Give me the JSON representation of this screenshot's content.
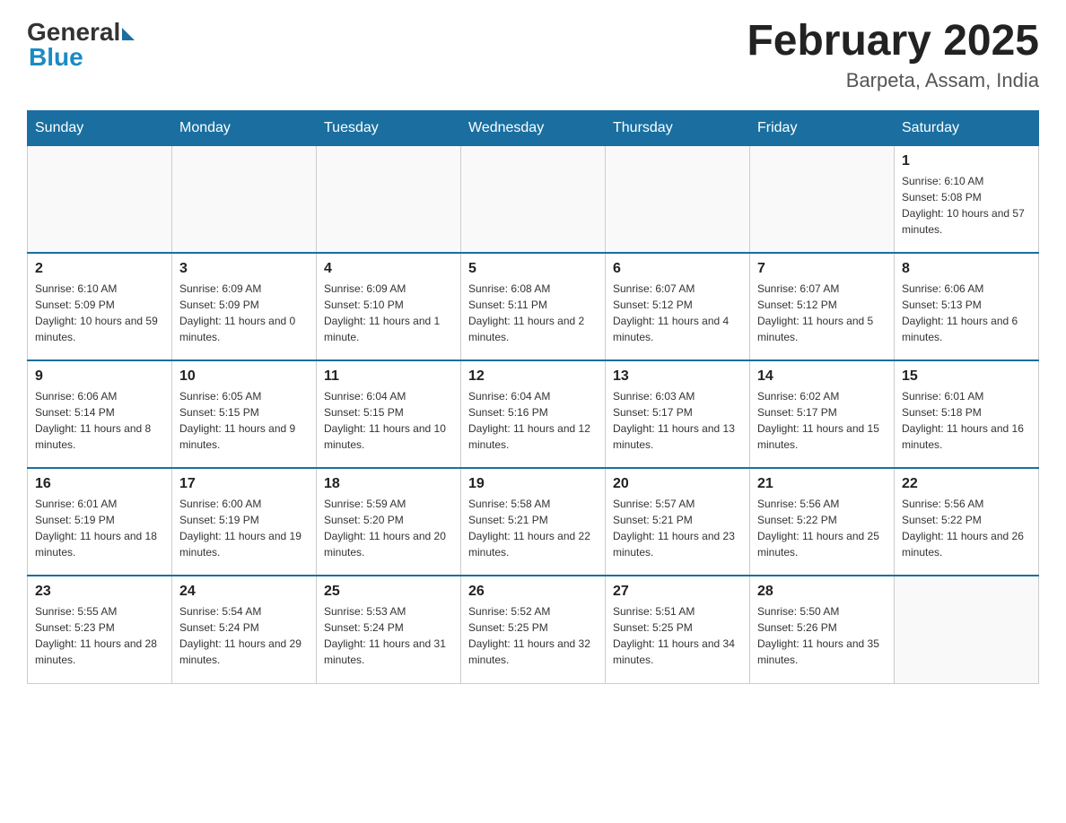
{
  "header": {
    "logo_general": "General",
    "logo_blue": "Blue",
    "month_title": "February 2025",
    "location": "Barpeta, Assam, India"
  },
  "days_of_week": [
    "Sunday",
    "Monday",
    "Tuesday",
    "Wednesday",
    "Thursday",
    "Friday",
    "Saturday"
  ],
  "weeks": [
    [
      {
        "day": "",
        "sunrise": "",
        "sunset": "",
        "daylight": ""
      },
      {
        "day": "",
        "sunrise": "",
        "sunset": "",
        "daylight": ""
      },
      {
        "day": "",
        "sunrise": "",
        "sunset": "",
        "daylight": ""
      },
      {
        "day": "",
        "sunrise": "",
        "sunset": "",
        "daylight": ""
      },
      {
        "day": "",
        "sunrise": "",
        "sunset": "",
        "daylight": ""
      },
      {
        "day": "",
        "sunrise": "",
        "sunset": "",
        "daylight": ""
      },
      {
        "day": "1",
        "sunrise": "Sunrise: 6:10 AM",
        "sunset": "Sunset: 5:08 PM",
        "daylight": "Daylight: 10 hours and 57 minutes."
      }
    ],
    [
      {
        "day": "2",
        "sunrise": "Sunrise: 6:10 AM",
        "sunset": "Sunset: 5:09 PM",
        "daylight": "Daylight: 10 hours and 59 minutes."
      },
      {
        "day": "3",
        "sunrise": "Sunrise: 6:09 AM",
        "sunset": "Sunset: 5:09 PM",
        "daylight": "Daylight: 11 hours and 0 minutes."
      },
      {
        "day": "4",
        "sunrise": "Sunrise: 6:09 AM",
        "sunset": "Sunset: 5:10 PM",
        "daylight": "Daylight: 11 hours and 1 minute."
      },
      {
        "day": "5",
        "sunrise": "Sunrise: 6:08 AM",
        "sunset": "Sunset: 5:11 PM",
        "daylight": "Daylight: 11 hours and 2 minutes."
      },
      {
        "day": "6",
        "sunrise": "Sunrise: 6:07 AM",
        "sunset": "Sunset: 5:12 PM",
        "daylight": "Daylight: 11 hours and 4 minutes."
      },
      {
        "day": "7",
        "sunrise": "Sunrise: 6:07 AM",
        "sunset": "Sunset: 5:12 PM",
        "daylight": "Daylight: 11 hours and 5 minutes."
      },
      {
        "day": "8",
        "sunrise": "Sunrise: 6:06 AM",
        "sunset": "Sunset: 5:13 PM",
        "daylight": "Daylight: 11 hours and 6 minutes."
      }
    ],
    [
      {
        "day": "9",
        "sunrise": "Sunrise: 6:06 AM",
        "sunset": "Sunset: 5:14 PM",
        "daylight": "Daylight: 11 hours and 8 minutes."
      },
      {
        "day": "10",
        "sunrise": "Sunrise: 6:05 AM",
        "sunset": "Sunset: 5:15 PM",
        "daylight": "Daylight: 11 hours and 9 minutes."
      },
      {
        "day": "11",
        "sunrise": "Sunrise: 6:04 AM",
        "sunset": "Sunset: 5:15 PM",
        "daylight": "Daylight: 11 hours and 10 minutes."
      },
      {
        "day": "12",
        "sunrise": "Sunrise: 6:04 AM",
        "sunset": "Sunset: 5:16 PM",
        "daylight": "Daylight: 11 hours and 12 minutes."
      },
      {
        "day": "13",
        "sunrise": "Sunrise: 6:03 AM",
        "sunset": "Sunset: 5:17 PM",
        "daylight": "Daylight: 11 hours and 13 minutes."
      },
      {
        "day": "14",
        "sunrise": "Sunrise: 6:02 AM",
        "sunset": "Sunset: 5:17 PM",
        "daylight": "Daylight: 11 hours and 15 minutes."
      },
      {
        "day": "15",
        "sunrise": "Sunrise: 6:01 AM",
        "sunset": "Sunset: 5:18 PM",
        "daylight": "Daylight: 11 hours and 16 minutes."
      }
    ],
    [
      {
        "day": "16",
        "sunrise": "Sunrise: 6:01 AM",
        "sunset": "Sunset: 5:19 PM",
        "daylight": "Daylight: 11 hours and 18 minutes."
      },
      {
        "day": "17",
        "sunrise": "Sunrise: 6:00 AM",
        "sunset": "Sunset: 5:19 PM",
        "daylight": "Daylight: 11 hours and 19 minutes."
      },
      {
        "day": "18",
        "sunrise": "Sunrise: 5:59 AM",
        "sunset": "Sunset: 5:20 PM",
        "daylight": "Daylight: 11 hours and 20 minutes."
      },
      {
        "day": "19",
        "sunrise": "Sunrise: 5:58 AM",
        "sunset": "Sunset: 5:21 PM",
        "daylight": "Daylight: 11 hours and 22 minutes."
      },
      {
        "day": "20",
        "sunrise": "Sunrise: 5:57 AM",
        "sunset": "Sunset: 5:21 PM",
        "daylight": "Daylight: 11 hours and 23 minutes."
      },
      {
        "day": "21",
        "sunrise": "Sunrise: 5:56 AM",
        "sunset": "Sunset: 5:22 PM",
        "daylight": "Daylight: 11 hours and 25 minutes."
      },
      {
        "day": "22",
        "sunrise": "Sunrise: 5:56 AM",
        "sunset": "Sunset: 5:22 PM",
        "daylight": "Daylight: 11 hours and 26 minutes."
      }
    ],
    [
      {
        "day": "23",
        "sunrise": "Sunrise: 5:55 AM",
        "sunset": "Sunset: 5:23 PM",
        "daylight": "Daylight: 11 hours and 28 minutes."
      },
      {
        "day": "24",
        "sunrise": "Sunrise: 5:54 AM",
        "sunset": "Sunset: 5:24 PM",
        "daylight": "Daylight: 11 hours and 29 minutes."
      },
      {
        "day": "25",
        "sunrise": "Sunrise: 5:53 AM",
        "sunset": "Sunset: 5:24 PM",
        "daylight": "Daylight: 11 hours and 31 minutes."
      },
      {
        "day": "26",
        "sunrise": "Sunrise: 5:52 AM",
        "sunset": "Sunset: 5:25 PM",
        "daylight": "Daylight: 11 hours and 32 minutes."
      },
      {
        "day": "27",
        "sunrise": "Sunrise: 5:51 AM",
        "sunset": "Sunset: 5:25 PM",
        "daylight": "Daylight: 11 hours and 34 minutes."
      },
      {
        "day": "28",
        "sunrise": "Sunrise: 5:50 AM",
        "sunset": "Sunset: 5:26 PM",
        "daylight": "Daylight: 11 hours and 35 minutes."
      },
      {
        "day": "",
        "sunrise": "",
        "sunset": "",
        "daylight": ""
      }
    ]
  ]
}
